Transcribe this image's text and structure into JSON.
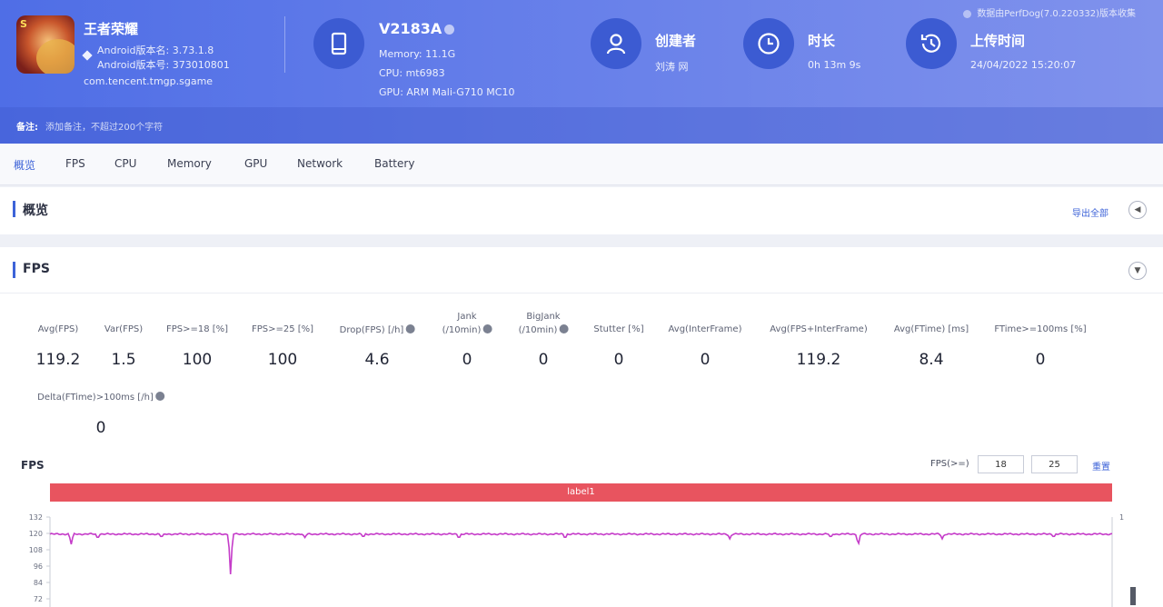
{
  "header": {
    "source_note": "数据由PerfDog(7.0.220332)版本收集",
    "app": {
      "name": "王者荣耀",
      "icon_badge": "S",
      "version_name": "Android版本名: 3.73.1.8",
      "version_code": "Android版本号: 373010801",
      "package": "com.tencent.tmgp.sgame"
    },
    "device": {
      "name": "V2183A",
      "memory": "Memory: 11.1G",
      "cpu": "CPU: mt6983",
      "gpu": "GPU: ARM Mali-G710 MC10",
      "icon": "phone-icon"
    },
    "creator": {
      "label": "创建者",
      "value": "刘涛 网",
      "icon": "user-icon"
    },
    "duration": {
      "label": "时长",
      "value": "0h 13m 9s",
      "icon": "clock-icon"
    },
    "upload_time": {
      "label": "上传时间",
      "value": "24/04/2022 15:20:07",
      "icon": "history-icon"
    },
    "note": {
      "label": "备注:",
      "placeholder": "添加备注，不超过200个字符"
    },
    "colors": {
      "gradient_start": "#4f6ee6",
      "gradient_end": "#8092ec",
      "icon_circle": "#3c5bd2"
    }
  },
  "tabs": [
    {
      "label": "概览",
      "active": true
    },
    {
      "label": "FPS"
    },
    {
      "label": "CPU"
    },
    {
      "label": "Memory"
    },
    {
      "label": "GPU"
    },
    {
      "label": "Network"
    },
    {
      "label": "Battery"
    }
  ],
  "overview": {
    "title": "概览",
    "export_label": "导出全部",
    "toggle_icon": "caret-left-icon"
  },
  "fps_section": {
    "title": "FPS",
    "toggle_icon": "caret-down-icon",
    "metrics": [
      {
        "label": "Avg(FPS)",
        "value": "119.2"
      },
      {
        "label": "Var(FPS)",
        "value": "1.5"
      },
      {
        "label": "FPS>=18 [%]",
        "value": "100"
      },
      {
        "label": "FPS>=25 [%]",
        "value": "100"
      },
      {
        "label": "Drop(FPS) [/h]",
        "value": "4.6",
        "help": true
      },
      {
        "label_top": "Jank",
        "label": "(/10min)",
        "value": "0",
        "help": true
      },
      {
        "label_top": "BigJank",
        "label": "(/10min)",
        "value": "0",
        "help": true
      },
      {
        "label": "Stutter [%]",
        "value": "0"
      },
      {
        "label": "Avg(InterFrame)",
        "value": "0"
      },
      {
        "label": "Avg(FPS+InterFrame)",
        "value": "119.2"
      },
      {
        "label": "Avg(FTime) [ms]",
        "value": "8.4"
      },
      {
        "label": "FTime>=100ms [%]",
        "value": "0"
      },
      {
        "label": "Delta(FTime)>100ms [/h]",
        "value": "0",
        "help": true
      }
    ],
    "chart_title": "FPS",
    "threshold_label": "FPS(>=)",
    "threshold_values": [
      "18",
      "25"
    ],
    "confirm_label": "重置",
    "label_bar": "label1"
  },
  "chart_data": {
    "type": "line",
    "title": "FPS",
    "y_ticks": [
      132,
      120,
      108,
      96,
      84,
      72
    ],
    "ylim": [
      68,
      132
    ],
    "y2_tick": "1",
    "series": [
      {
        "color": "#c53cc9",
        "baseline": 119.5,
        "dips": [
          {
            "at": 0.02,
            "value": 112
          },
          {
            "at": 0.045,
            "value": 116
          },
          {
            "at": 0.105,
            "value": 117
          },
          {
            "at": 0.17,
            "value": 90
          },
          {
            "at": 0.24,
            "value": 117
          },
          {
            "at": 0.295,
            "value": 117
          },
          {
            "at": 0.385,
            "value": 116
          },
          {
            "at": 0.485,
            "value": 116
          },
          {
            "at": 0.64,
            "value": 116
          },
          {
            "at": 0.735,
            "value": 117
          },
          {
            "at": 0.761,
            "value": 111
          },
          {
            "at": 0.84,
            "value": 116
          },
          {
            "at": 0.945,
            "value": 117
          }
        ]
      }
    ]
  }
}
